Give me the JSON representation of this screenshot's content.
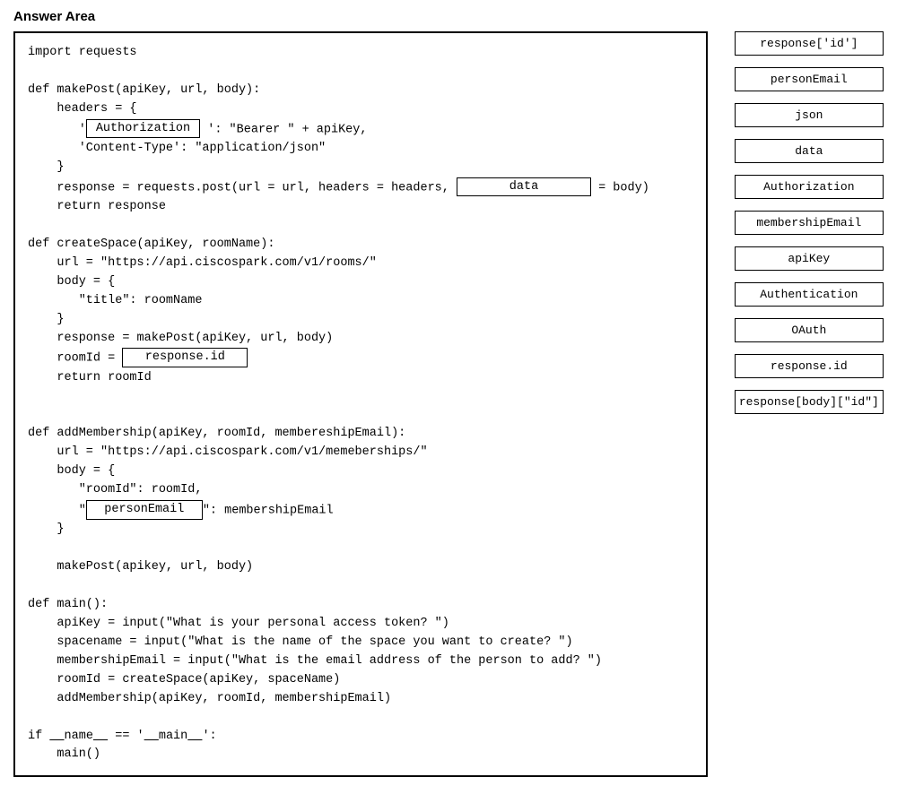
{
  "header": "Answer Area",
  "code": {
    "l1": "import requests",
    "l3": "def makePost(apiKey, url, body):",
    "l4": "    headers = {",
    "l5a": "       '",
    "blank1": "Authorization",
    "l5b": "': \"Bearer \" + apiKey,",
    "l6": "       'Content-Type': \"application/json\"",
    "l7": "    }",
    "l8a": "    response = requests.post(url = url, headers = headers, ",
    "blank2": "data",
    "l8b": " = body)",
    "l9": "    return response",
    "l11": "def createSpace(apiKey, roomName):",
    "l12": "    url = \"https://api.ciscospark.com/v1/rooms/\"",
    "l13": "    body = {",
    "l14": "       \"title\": roomName",
    "l15": "    }",
    "l16": "    response = makePost(apiKey, url, body)",
    "l17a": "    roomId = ",
    "blank3": "response.id",
    "l18": "    return roomId",
    "l21": "def addMembership(apiKey, roomId, membereshipEmail):",
    "l22": "    url = \"https://api.ciscospark.com/v1/memeberships/\"",
    "l23": "    body = {",
    "l24": "       \"roomId\": roomId,",
    "l25a": "       \"",
    "blank4": "personEmail",
    "l25b": "\": membershipEmail",
    "l26": "    }",
    "l28": "    makePost(apikey, url, body)",
    "l30": "def main():",
    "l31": "    apiKey = input(\"What is your personal access token? \")",
    "l32": "    spacename = input(\"What is the name of the space you want to create? \")",
    "l33": "    membershipEmail = input(\"What is the email address of the person to add? \")",
    "l34": "    roomId = createSpace(apiKey, spaceName)",
    "l35": "    addMembership(apiKey, roomId, membershipEmail)",
    "l37a": "if ",
    "l37b": "name",
    "l37c": " == '",
    "l37d": "main",
    "l37e": "':",
    "l38": "    main()"
  },
  "options": [
    "response['id']",
    "personEmail",
    "json",
    "data",
    "Authorization",
    "membershipEmail",
    "apiKey",
    "Authentication",
    "OAuth",
    "response.id",
    "response[body][\"id\"]"
  ]
}
